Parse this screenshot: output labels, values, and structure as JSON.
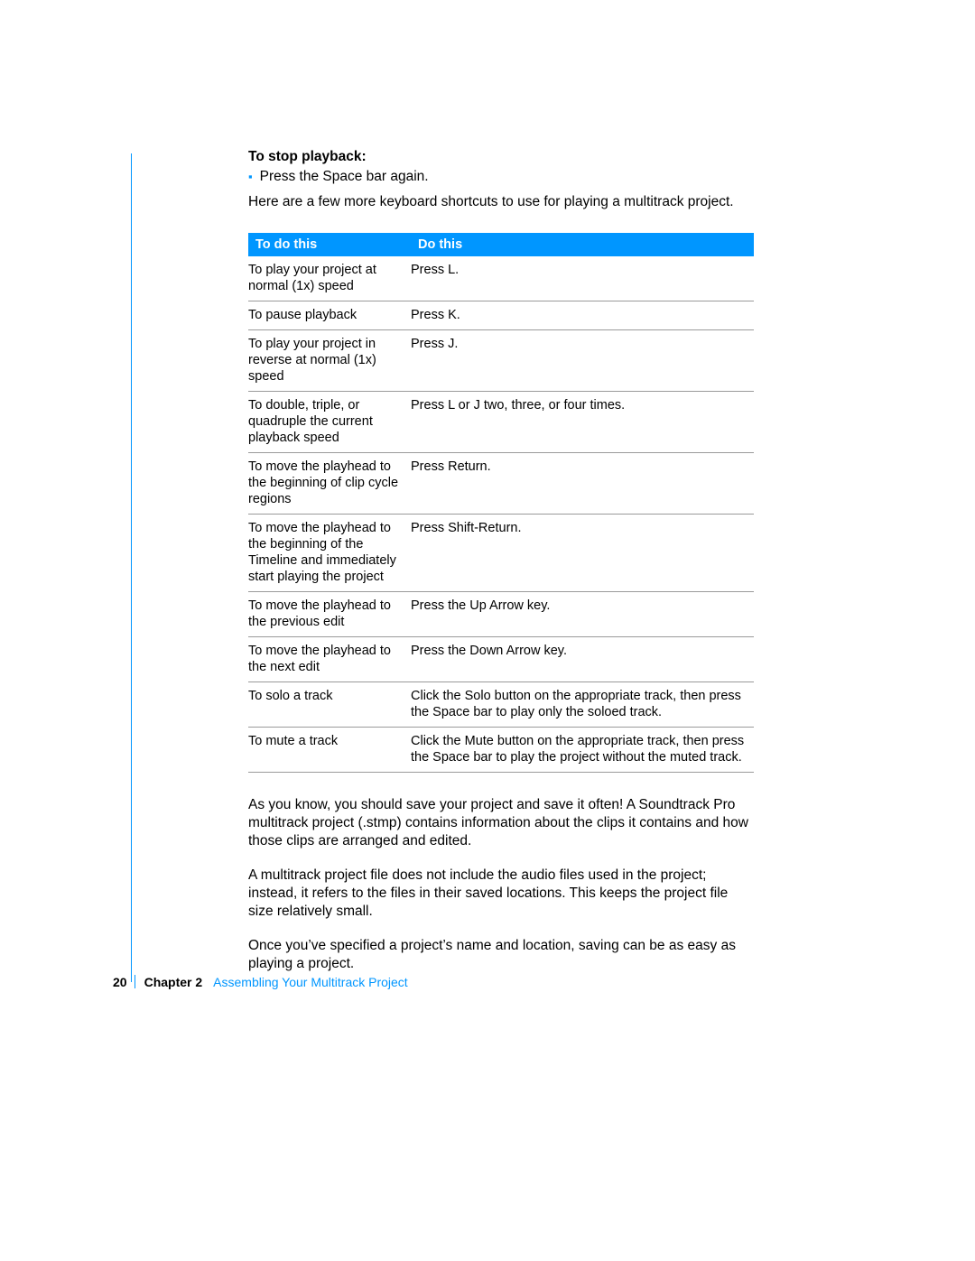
{
  "section_heading": "To stop playback:",
  "bullet_marker": "▪",
  "bullet_text": "Press the Space bar again.",
  "intro_para": "Here are a few more keyboard shortcuts to use for playing a multitrack project.",
  "table": {
    "header": {
      "col1": "To do this",
      "col2": "Do this"
    },
    "rows": [
      {
        "todo": "To play your project at normal (1x) speed",
        "dothis": "Press L."
      },
      {
        "todo": "To pause playback",
        "dothis": "Press K."
      },
      {
        "todo": "To play your project in reverse at normal (1x) speed",
        "dothis": "Press J."
      },
      {
        "todo": "To double, triple, or quadruple the current playback speed",
        "dothis": "Press L or J two, three, or four times."
      },
      {
        "todo": "To move the playhead to the beginning of clip cycle regions",
        "dothis": "Press Return."
      },
      {
        "todo": "To move the playhead to the beginning of the Timeline and immediately start playing the project",
        "dothis": "Press Shift-Return."
      },
      {
        "todo": "To move the playhead to the previous edit",
        "dothis": "Press the Up Arrow key."
      },
      {
        "todo": "To move the playhead to the next edit",
        "dothis": "Press the Down Arrow key."
      },
      {
        "todo": "To solo a track",
        "dothis": "Click the Solo button on the appropriate track, then press the Space bar to play only the soloed track."
      },
      {
        "todo": "To mute a track",
        "dothis": "Click the Mute button on the appropriate track, then press the Space bar to play the project without the muted track."
      }
    ]
  },
  "para1": "As you know, you should save your project and save it often! A Soundtrack Pro multitrack project (.stmp) contains information about the clips it contains and how those clips are arranged and edited.",
  "para2": "A multitrack project file does not include the audio files used in the project; instead, it refers to the files in their saved locations. This keeps the project file size relatively small.",
  "para3": "Once you’ve specified a project’s name and location, saving can be as easy as playing a project.",
  "footer": {
    "page_number": "20",
    "chapter_label": "Chapter 2",
    "chapter_title": "Assembling Your Multitrack Project"
  }
}
